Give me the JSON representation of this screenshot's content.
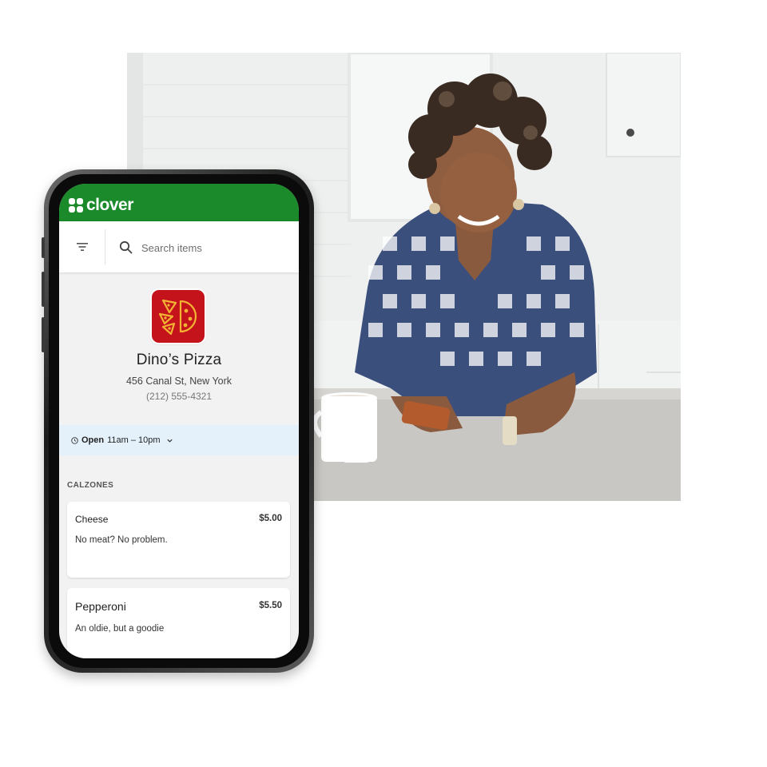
{
  "app": {
    "brand": "clover",
    "brand_color": "#1a8a2a"
  },
  "search": {
    "placeholder": "Search items",
    "value": ""
  },
  "icons": {
    "filter": "filter-icon",
    "search": "search-icon",
    "clock": "clock-icon",
    "expand": "chevron-down-icon",
    "merchant_logo": "pizza-logo-icon"
  },
  "merchant": {
    "name": "Dino’s Pizza",
    "address": "456 Canal St, New York",
    "phone": "(212) 555-4321",
    "logo_color": "#c4131b"
  },
  "hours": {
    "status": "Open",
    "range": "11am – 10pm"
  },
  "menu": {
    "category": "CALZONES",
    "items": [
      {
        "name": "Cheese",
        "price": "$5.00",
        "description": "No meat? No problem."
      },
      {
        "name": "Pepperoni",
        "price": "$5.50",
        "description": "An oldie, but a goodie"
      }
    ]
  }
}
